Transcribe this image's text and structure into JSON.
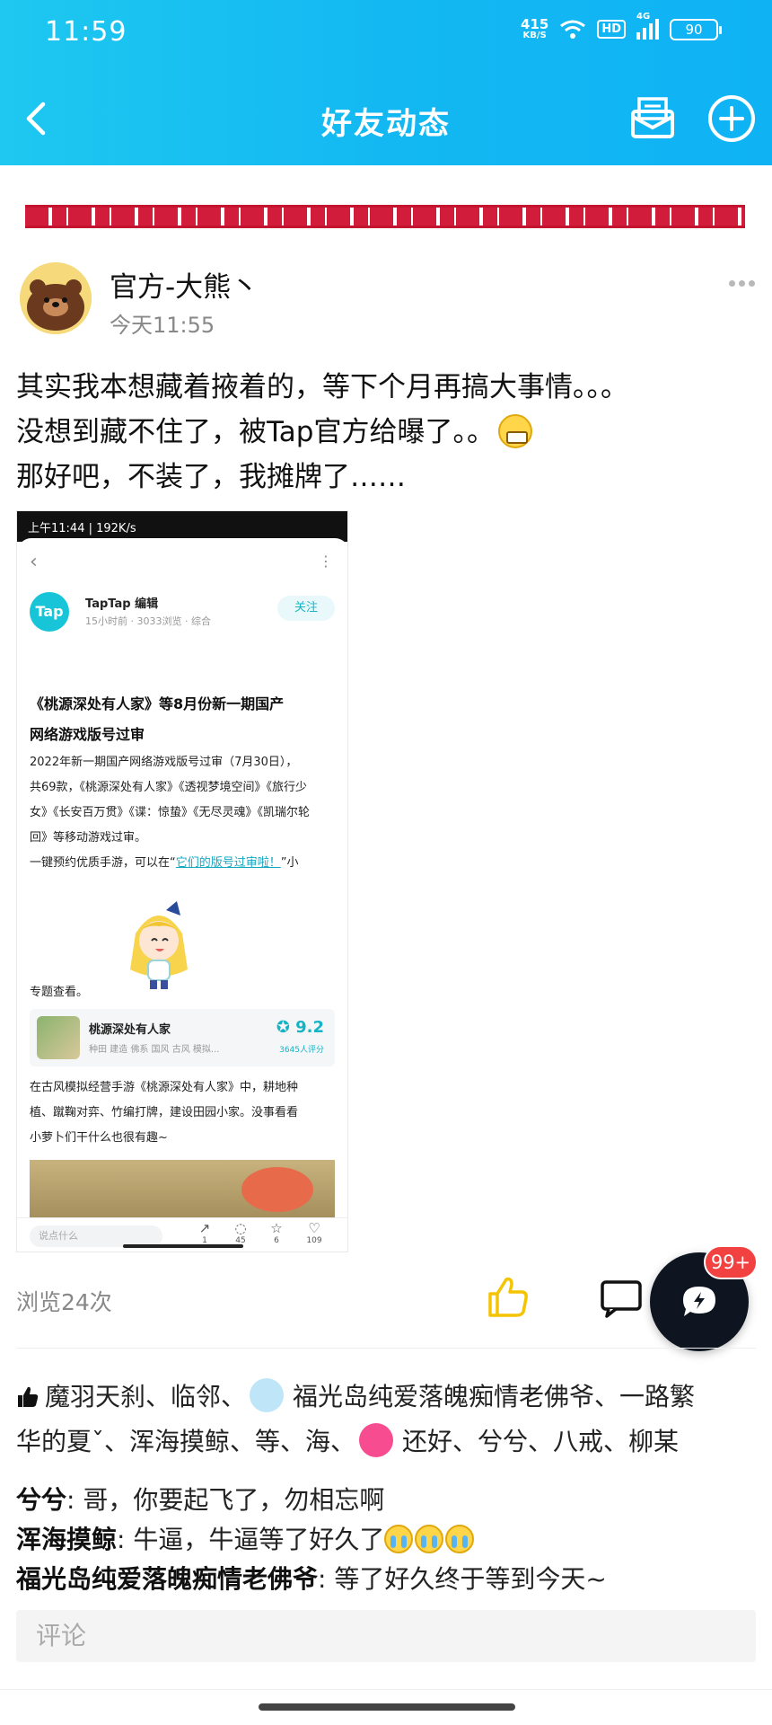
{
  "status_bar": {
    "time": "11:59",
    "speed_value": "415",
    "speed_unit": "KB/S",
    "hd": "HD",
    "network": "4G",
    "battery": "90"
  },
  "nav": {
    "title": "好友动态",
    "back_icon": "chevron-left-icon",
    "mail_icon": "mail-icon",
    "add_icon": "plus-circle-icon"
  },
  "post": {
    "author": "官方-大熊丶",
    "time": "今天11:55",
    "lines": [
      "其实我本想藏着掖着的，等下个月再搞大事情。。。",
      "没想到藏不住了，被Tap官方给曝了。。",
      "那好吧，不装了，我摊牌了……"
    ],
    "views": "浏览24次"
  },
  "embedded": {
    "status_time": "上午11:44 | 192K/s",
    "badge": "Tap",
    "editor": "TapTap 编辑",
    "meta": "15小时前 · 3033浏览 · 综合",
    "follow": "关注",
    "headline_1": "《桃源深处有人家》等8月份新一期国产",
    "headline_2": "网络游戏版号过审",
    "body_1": "2022年新一期国产网络游戏版号过审（7月30日），",
    "body_2": "共69款，《桃源深处有人家》《透视梦境空间》《旅行少",
    "body_3": "女》《长安百万贯》《谍：惊蛰》《无尽灵魂》《凯瑞尔轮",
    "body_4": "回》等移动游戏过审。",
    "body_5_prefix": "一键预约优质手游，可以在“",
    "body_5_link": "它们的版号过审啦！",
    "body_5_suffix": "”小",
    "topic": "专题查看。",
    "game": {
      "name": "桃源深处有人家",
      "tags": "种田  建造  佛系  国风  古风  模拟...",
      "score": "9.2",
      "count": "3645人评分"
    },
    "desc_1": "在古风模拟经营手游《桃源深处有人家》中，耕地种",
    "desc_2": "植、蹴鞠对弈、竹编打牌，建设田园小家。没事看看",
    "desc_3": "小萝卜们干什么也很有趣~",
    "input_placeholder": "说点什么",
    "counts": {
      "share": "1",
      "comment": "45",
      "fav": "6",
      "like": "109"
    }
  },
  "fab": {
    "badge": "99+"
  },
  "likes": {
    "line1_a": "魔羽天刹、临邻、",
    "line1_b": "福光岛纯爱落魄痴情老佛爷、一路繁",
    "line2_a": "华的夏ˇ、浑海摸鲸、等、海、",
    "line2_b": "还好、兮兮、八戒、柳某"
  },
  "comments": [
    {
      "user": "兮兮",
      "text": ": 哥，你要起飞了，勿相忘啊"
    },
    {
      "user": "浑海摸鲸",
      "text": ": 牛逼，牛逼等了好久了"
    },
    {
      "user": "福光岛纯爱落魄痴情老佛爷",
      "text": ": 等了好久终于等到今天~"
    }
  ],
  "comment_input": {
    "placeholder": "评论"
  },
  "colors": {
    "header": "#13b8f2",
    "accent": "#15b3c6",
    "like": "#f5c400",
    "badge": "#f24141"
  }
}
